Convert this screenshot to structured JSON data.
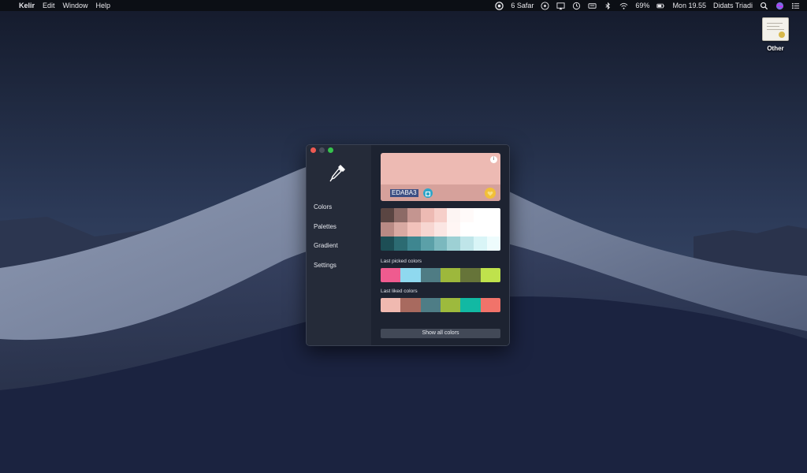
{
  "menubar": {
    "apple_glyph": "",
    "app_name": "Kelir",
    "menus": [
      "Edit",
      "Window",
      "Help"
    ],
    "status_text": "6 Safar",
    "battery": "69%",
    "clock": "Mon 19.55",
    "user": "Didats Triadi",
    "icons": [
      "hijri-calendar-icon",
      "dropbox-icon",
      "airplay-icon",
      "time-machine-icon",
      "keyboard-icon",
      "bluetooth-icon",
      "wifi-icon",
      "battery-icon",
      "spotlight-icon",
      "siri-icon",
      "notification-center-icon"
    ]
  },
  "desktop": {
    "icon_label": "Other"
  },
  "app": {
    "sidebar": {
      "icon": "eyedropper-icon",
      "items": [
        "Colors",
        "Palettes",
        "Gradient",
        "Settings"
      ]
    },
    "current_color": {
      "hex": "EDABA3",
      "swatch": "#edbab3",
      "shade": "#d6a19b"
    },
    "shades_grid": [
      [
        "#5a4542",
        "#8c6a66",
        "#c49590",
        "#edbab3",
        "#f6cfc9",
        "#fdf5f3",
        "#fffaf9",
        "#ffffff",
        "#ffffff"
      ],
      [
        "#b88a84",
        "#d8a9a2",
        "#f2c2bb",
        "#f7d6d1",
        "#fbe6e3",
        "#fff6f4",
        "#ffffff",
        "#ffffff",
        "#ffffff"
      ],
      [
        "#1d4e55",
        "#2c6b72",
        "#3e8690",
        "#5ba0a8",
        "#7bb8be",
        "#9dd0d4",
        "#bfe5e9",
        "#d9f5f7",
        "#eefcfd"
      ]
    ],
    "last_picked": {
      "label": "Last picked colors",
      "colors": [
        "#ef5b8f",
        "#8fd9ef",
        "#4f7c84",
        "#9db83c",
        "#667439",
        "#bfe24c"
      ]
    },
    "last_liked": {
      "label": "Last liked colors",
      "colors": [
        "#f0b9b0",
        "#a86a5f",
        "#4e7d86",
        "#9dba3d",
        "#12b9a3",
        "#f1736a"
      ]
    },
    "show_all_label": "Show all colors"
  }
}
